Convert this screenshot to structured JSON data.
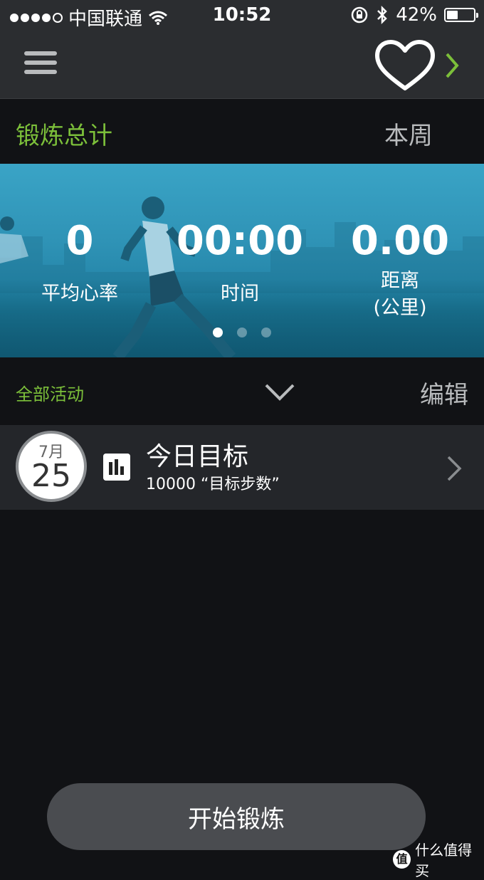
{
  "status_bar": {
    "carrier": "中国联通",
    "time": "10:52",
    "battery": "42%",
    "battery_level": 0.42,
    "signal_bars_filled": 4,
    "signal_bars_total": 5
  },
  "header": {
    "menu_icon": "hamburger-icon",
    "heart_icon": "heart-icon",
    "next_icon": "chevron-right-icon"
  },
  "summary": {
    "title": "锻炼总计",
    "period": "本周"
  },
  "banner": {
    "stats": [
      {
        "value": "0",
        "label": "平均心率"
      },
      {
        "value": "00:00",
        "label": "时间"
      },
      {
        "value": "0.00",
        "label": "距离",
        "unit": "(公里)"
      }
    ],
    "page_count": 3,
    "active_page": 0
  },
  "activities": {
    "filter_label": "全部活动",
    "edit_label": "编辑"
  },
  "goal": {
    "month": "7月",
    "day": "25",
    "title": "今日目标",
    "subtitle": "10000 “目标步数”"
  },
  "start_button": {
    "label": "开始锻炼"
  },
  "watermark": {
    "logo": "值",
    "text": "什么值得买"
  },
  "colors": {
    "accent_green": "#7cbf3a",
    "bar_background": "#2b2d30",
    "page_background": "#111215",
    "banner_blue": "#2f93b6"
  }
}
